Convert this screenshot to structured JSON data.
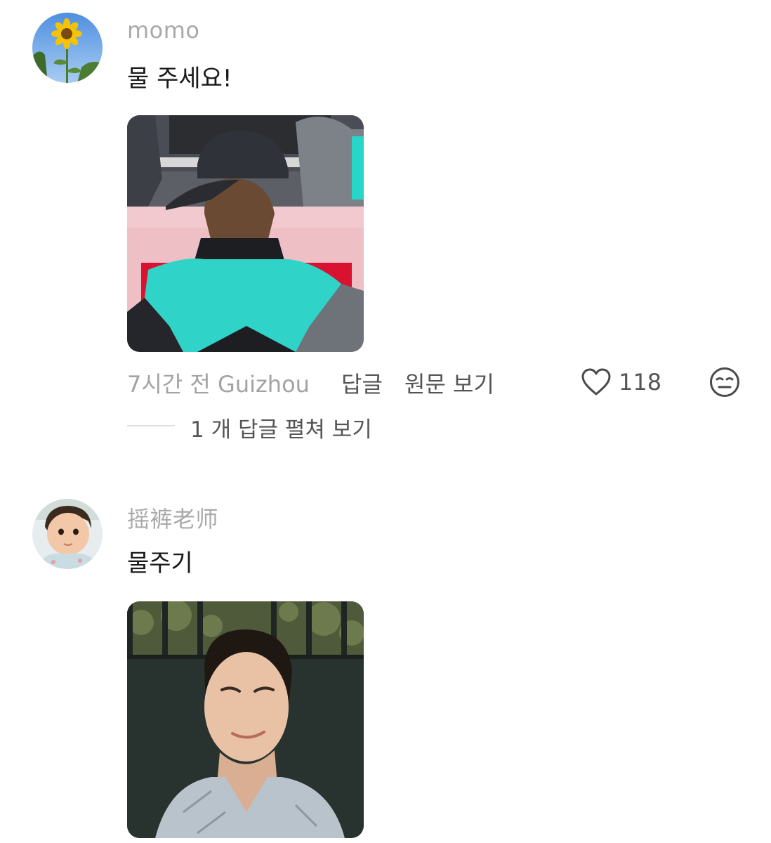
{
  "comments": [
    {
      "username": "momo",
      "text": "물 주세요!",
      "avatar_icon": "sunflower-avatar",
      "image_icon": "person-cap-back-photo",
      "time_location": "7시간 전 Guizhou",
      "reply_label": "답글",
      "view_original_label": "원문 보기",
      "like_count": "118",
      "like_icon": "heart-outline-icon",
      "reaction_icon": "emoji-face-icon",
      "replies_label": "1 개 답글 펼쳐 보기"
    },
    {
      "username": "摇裤老师",
      "text": "물주기",
      "avatar_icon": "baby-avatar",
      "image_icon": "smiling-person-photo"
    }
  ],
  "colors": {
    "username": "#a9a9a9",
    "text": "#1a1a1a",
    "meta": "#a3a3a3",
    "action": "#555555"
  }
}
